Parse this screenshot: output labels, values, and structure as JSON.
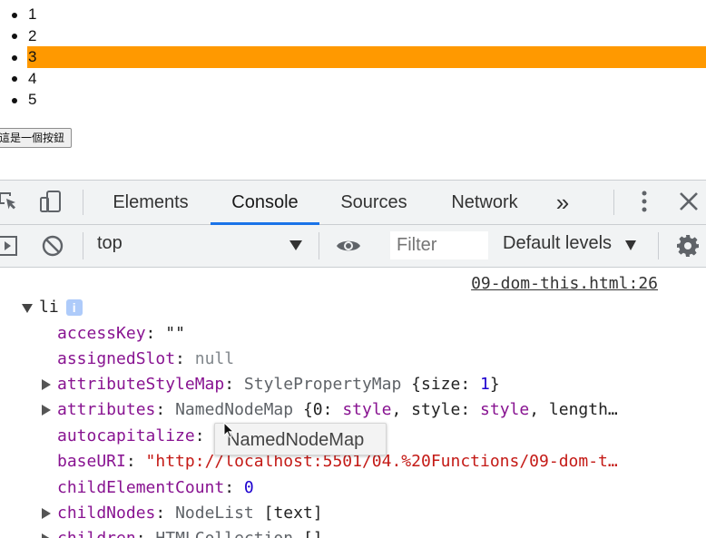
{
  "page": {
    "list_items": [
      "1",
      "2",
      "3",
      "4",
      "5"
    ],
    "highlighted_index": 2,
    "highlight_color": "#ff9900",
    "button_label": "這是一個按鈕"
  },
  "devtools": {
    "tabs": [
      "Elements",
      "Console",
      "Sources",
      "Network"
    ],
    "active_tab": "Console",
    "more_tabs_glyph": "»",
    "toolbar": {
      "context": "top",
      "filter_placeholder": "Filter",
      "levels": "Default levels"
    },
    "console": {
      "source_link": "09-dom-this.html:26",
      "object_label": "li",
      "info_badge": "i",
      "props": [
        {
          "key": "accessKey",
          "value": "\"\"",
          "type": "str",
          "expandable": false
        },
        {
          "key": "assignedSlot",
          "value": "null",
          "type": "nul",
          "expandable": false
        },
        {
          "key": "attributeStyleMap",
          "cls": "StylePropertyMap",
          "rest": "{size: 1}",
          "expandable": true
        },
        {
          "key": "attributes",
          "cls": "NamedNodeMap",
          "rest": "{0: style, style: style, length…",
          "expandable": true
        },
        {
          "key": "autocapitalize",
          "value": "\"\"",
          "type": "str",
          "expandable": false
        },
        {
          "key": "baseURI",
          "value": "\"http://localhost:5501/04.%20Functions/09-dom-t…",
          "type": "str",
          "expandable": false
        },
        {
          "key": "childElementCount",
          "value": "0",
          "type": "num",
          "expandable": false
        },
        {
          "key": "childNodes",
          "cls": "NodeList",
          "rest": "[text]",
          "expandable": true
        },
        {
          "key": "children",
          "cls": "HTMLCollection",
          "rest": "[]",
          "expandable": true
        }
      ],
      "tooltip": "NamedNodeMap"
    }
  },
  "colors": {
    "accent": "#1a73e8",
    "key": "#881391",
    "string": "#c41a16",
    "number": "#1c00cf"
  }
}
